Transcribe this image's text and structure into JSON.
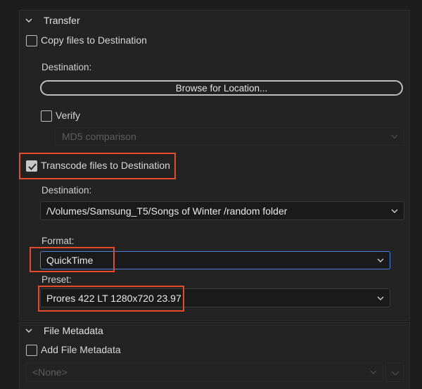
{
  "transfer": {
    "header": "Transfer",
    "copy_files_label": "Copy files to Destination",
    "destination_label": "Destination:",
    "browse_label": "Browse for Location...",
    "verify_label": "Verify",
    "verify_method": "MD5 comparison",
    "transcode_label": "Transcode files to Destination",
    "transcode_checked": true,
    "transcode_destination_label": "Destination:",
    "transcode_destination_value": "/Volumes/Samsung_T5/Songs of Winter /random folder",
    "format_label": "Format:",
    "format_value": "QuickTime",
    "preset_label": "Preset:",
    "preset_value": "Prores 422 LT 1280x720 23.97"
  },
  "file_metadata": {
    "header": "File Metadata",
    "add_label": "Add File Metadata",
    "template_value": "<None>"
  },
  "colors": {
    "highlight": "#e34b2c",
    "focus": "#4f7fd8",
    "background": "#1d1d1d",
    "panel": "#232323"
  }
}
